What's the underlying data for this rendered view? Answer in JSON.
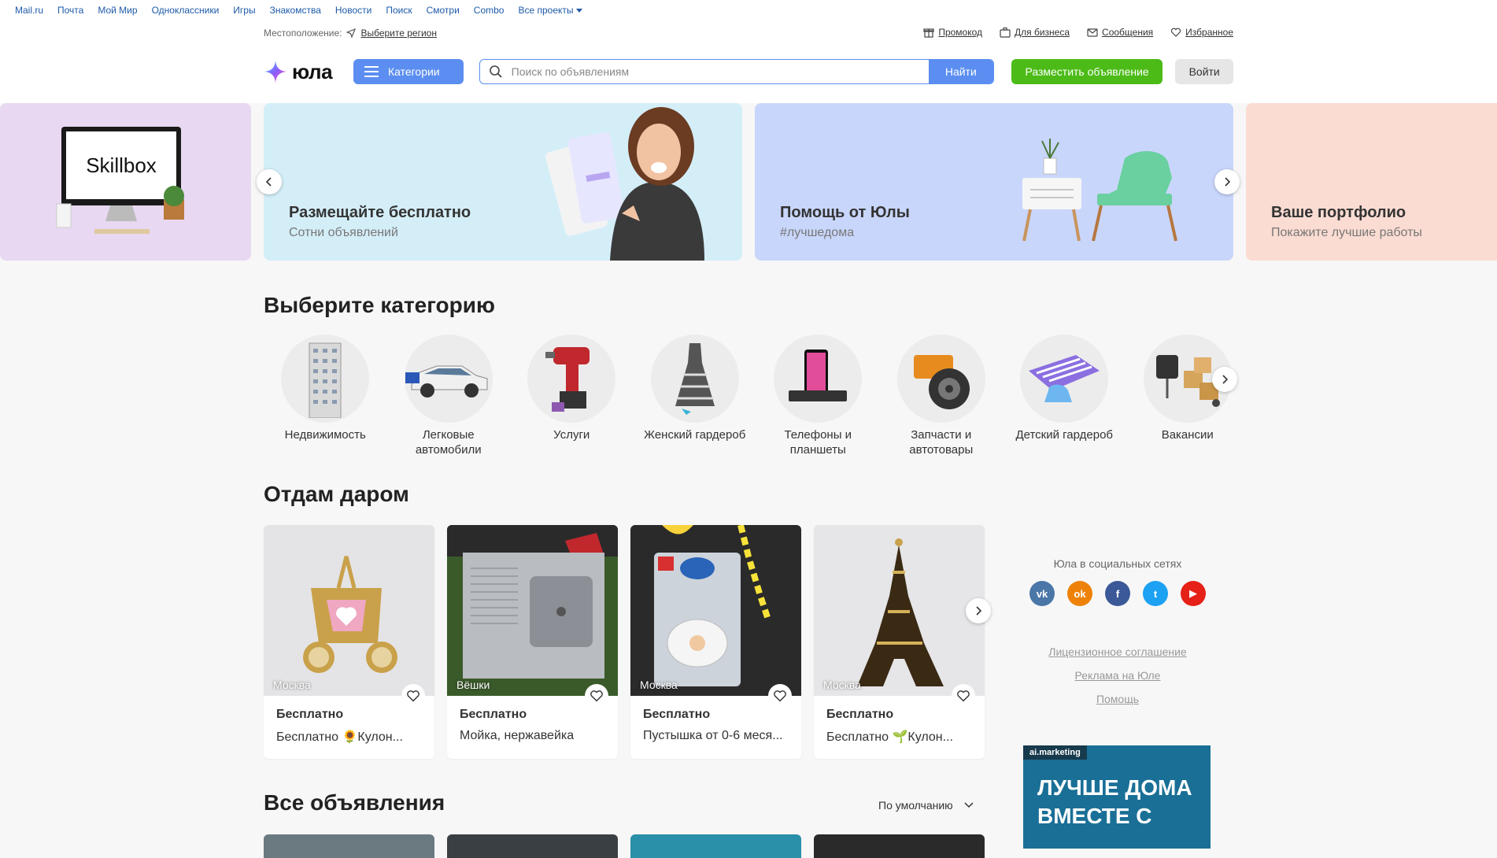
{
  "portal": {
    "links": [
      "Mail.ru",
      "Почта",
      "Мой Мир",
      "Одноклассники",
      "Игры",
      "Знакомства",
      "Новости",
      "Поиск",
      "Смотри",
      "Combo"
    ],
    "all_projects": "Все проекты"
  },
  "header": {
    "location_label": "Местоположение:",
    "location_link": "Выберите регион",
    "top_links": {
      "promo": "Промокод",
      "business": "Для бизнеса",
      "messages": "Сообщения",
      "favorites": "Избранное"
    },
    "logo_text": "юла",
    "categories_button": "Категории",
    "search_placeholder": "Поиск по объявлениям",
    "search_button": "Найти",
    "post_button": "Разместить объявление",
    "login_button": "Войти"
  },
  "banners": [
    {
      "title": "",
      "subtitle": "",
      "brand": "Skillbox"
    },
    {
      "title": "Размещайте бесплатно",
      "subtitle": "Сотни объявлений"
    },
    {
      "title": "Помощь от Юлы",
      "subtitle": "#лучшедома"
    },
    {
      "title": "Ваше портфолио",
      "subtitle": "Покажите лучшие работы"
    }
  ],
  "categories_section": {
    "title": "Выберите категорию",
    "items": [
      "Недвижимость",
      "Легковые автомобили",
      "Услуги",
      "Женский гардероб",
      "Телефоны и планшеты",
      "Запчасти и автотовары",
      "Детский гардероб",
      "Вакансии"
    ]
  },
  "free_section": {
    "title": "Отдам даром",
    "cards": [
      {
        "city": "Москва",
        "price": "Бесплатно",
        "title": "Бесплатно 🌻Кулон..."
      },
      {
        "city": "Вёшки",
        "price": "Бесплатно",
        "title": "Мойка, нержавейка"
      },
      {
        "city": "Москва",
        "price": "Бесплатно",
        "title": "Пустышка от 0-6 меся..."
      },
      {
        "city": "Москва",
        "price": "Бесплатно",
        "title": "Бесплатно 🌱Кулон..."
      }
    ]
  },
  "social": {
    "title": "Юла в социальных сетях",
    "networks": [
      "vk",
      "ok",
      "facebook",
      "twitter",
      "youtube"
    ]
  },
  "footer_links": [
    "Лицензионное соглашение",
    "Реклама на Юле",
    "Помощь"
  ],
  "ad": {
    "tag": "ai.marketing",
    "text_line1": "ЛУЧШЕ ДОМА",
    "text_line2": "ВМЕСТЕ С"
  },
  "all_section": {
    "title": "Все объявления",
    "sort_label": "По умолчанию"
  },
  "colors": {
    "accent_blue": "#5b8ef0",
    "post_green": "#4cbb17",
    "link_blue": "#1e5aa8"
  }
}
